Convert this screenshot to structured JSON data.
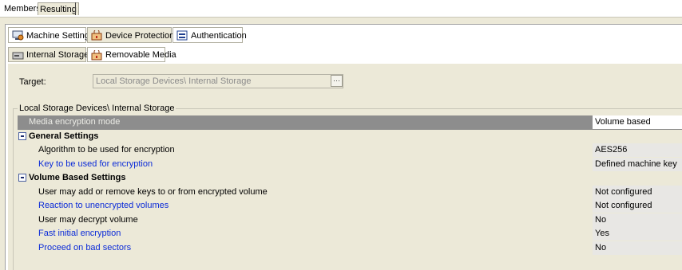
{
  "top_tabs": {
    "members": "Members",
    "resulting": "Resulting"
  },
  "policy_tabs": [
    {
      "label": "Machine Settings",
      "icon": "machine-settings-icon"
    },
    {
      "label": "Device Protection",
      "icon": "device-protection-icon"
    },
    {
      "label": "Authentication",
      "icon": "authentication-icon"
    }
  ],
  "device_tabs": [
    {
      "label": "Internal Storage",
      "icon": "internal-storage-icon"
    },
    {
      "label": "Removable Media",
      "icon": "removable-media-icon"
    }
  ],
  "target": {
    "label": "Target:",
    "value": "Local Storage Devices\\ Internal Storage",
    "browse": "···"
  },
  "group_title": "Local Storage Devices\\ Internal Storage",
  "grid": {
    "header": {
      "name": "Media encryption mode",
      "value": "Volume based"
    },
    "general": {
      "title": "General Settings",
      "rows": [
        {
          "name": "Algorithm to be used for encryption",
          "value": "AES256"
        },
        {
          "name": "Key to be used for encryption",
          "value": "Defined machine key"
        }
      ]
    },
    "volume": {
      "title": "Volume Based Settings",
      "rows": [
        {
          "name": "User may add or remove keys to or from encrypted volume",
          "value": "Not configured"
        },
        {
          "name": "Reaction to unencrypted volumes",
          "value": "Not configured"
        },
        {
          "name": "User may decrypt volume",
          "value": "No"
        },
        {
          "name": "Fast initial encryption",
          "value": "Yes"
        },
        {
          "name": "Proceed on bad sectors",
          "value": "No"
        }
      ]
    }
  },
  "colors": {
    "header_row": "#8d8d8d",
    "link": "#0b2bd8",
    "background": "#ece9d8"
  }
}
